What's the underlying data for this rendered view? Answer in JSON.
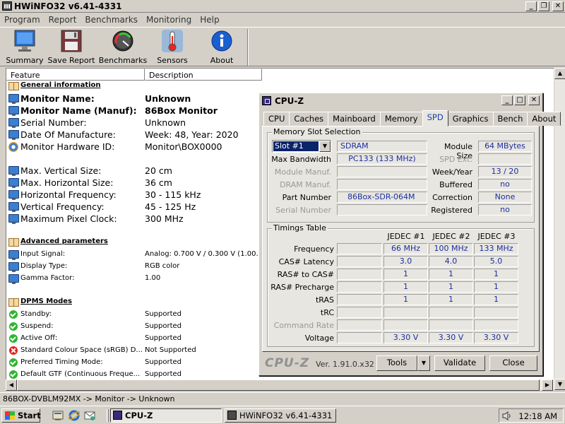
{
  "hwinfo": {
    "title": "HWiNFO32 v6.41-4331",
    "menu": [
      "Program",
      "Report",
      "Benchmarks",
      "Monitoring",
      "Help"
    ],
    "toolbar": [
      "Summary",
      "Save Report",
      "Benchmarks",
      "Sensors",
      "About"
    ],
    "columns": [
      "Feature",
      "Description"
    ],
    "sections": {
      "general": "General information",
      "advanced": "Advanced parameters",
      "dpms": "DPMS Modes"
    },
    "rows": [
      {
        "f": "Monitor Name:",
        "d": "Unknown"
      },
      {
        "f": "Monitor Name (Manuf):",
        "d": "86Box Monitor"
      },
      {
        "f": "Serial Number:",
        "d": "Unknown"
      },
      {
        "f": "Date Of Manufacture:",
        "d": "Week: 48, Year: 2020"
      },
      {
        "f": "Monitor Hardware ID:",
        "d": "Monitor\\BOX0000"
      },
      {
        "f": "Max. Vertical Size:",
        "d": "20 cm"
      },
      {
        "f": "Max. Horizontal Size:",
        "d": "36 cm"
      },
      {
        "f": "Horizontal Frequency:",
        "d": "30 - 115 kHz"
      },
      {
        "f": "Vertical Frequency:",
        "d": "45 - 125 Hz"
      },
      {
        "f": "Maximum Pixel Clock:",
        "d": "300 MHz"
      },
      {
        "f": "Input Signal:",
        "d": "Analog: 0.700 V / 0.300 V (1.00..."
      },
      {
        "f": "Display Type:",
        "d": "RGB color"
      },
      {
        "f": "Gamma Factor:",
        "d": "1.00"
      },
      {
        "f": "Standby:",
        "d": "Supported"
      },
      {
        "f": "Suspend:",
        "d": "Supported"
      },
      {
        "f": "Active Off:",
        "d": "Supported"
      },
      {
        "f": "Standard Colour Space (sRGB) D...",
        "d": "Not Supported"
      },
      {
        "f": "Preferred Timing Mode:",
        "d": "Supported"
      },
      {
        "f": "Default GTF (Continuous Freque...",
        "d": "Supported"
      }
    ],
    "status": "86BOX-DVBLM92MX -> Monitor -> Unknown"
  },
  "cpuz": {
    "title": "CPU-Z",
    "tabs": [
      "CPU",
      "Caches",
      "Mainboard",
      "Memory",
      "SPD",
      "Graphics",
      "Bench",
      "About"
    ],
    "active_tab": "SPD",
    "slot_group": "Memory Slot Selection",
    "slot": "Slot #1",
    "mem_type": "SDRAM",
    "labels": {
      "max_bw": "Max Bandwidth",
      "mod_manuf": "Module Manuf.",
      "dram_manuf": "DRAM Manuf.",
      "part": "Part Number",
      "serial": "Serial Number",
      "mod_size": "Module Size",
      "spd_ext": "SPD Ext.",
      "weekyear": "Week/Year",
      "buffered": "Buffered",
      "correction": "Correction",
      "registered": "Registered"
    },
    "values": {
      "max_bw": "PC133 (133 MHz)",
      "part": "86Box-SDR-064M",
      "mod_size": "64 MBytes",
      "weekyear": "13 / 20",
      "buffered": "no",
      "correction": "None",
      "registered": "no"
    },
    "timings": {
      "group": "Timings Table",
      "cols": [
        "JEDEC #1",
        "JEDEC #2",
        "JEDEC #3"
      ],
      "rows": [
        {
          "label": "Frequency",
          "v": [
            "66 MHz",
            "100 MHz",
            "133 MHz"
          ],
          "dim": false
        },
        {
          "label": "CAS# Latency",
          "v": [
            "3.0",
            "4.0",
            "5.0"
          ],
          "dim": false
        },
        {
          "label": "RAS# to CAS#",
          "v": [
            "1",
            "1",
            "1"
          ],
          "dim": false
        },
        {
          "label": "RAS# Precharge",
          "v": [
            "1",
            "1",
            "1"
          ],
          "dim": false
        },
        {
          "label": "tRAS",
          "v": [
            "1",
            "1",
            "1"
          ],
          "dim": false
        },
        {
          "label": "tRC",
          "v": [
            "",
            "",
            ""
          ],
          "dim": false
        },
        {
          "label": "Command Rate",
          "v": [
            "",
            "",
            ""
          ],
          "dim": true
        },
        {
          "label": "Voltage",
          "v": [
            "3.30 V",
            "3.30 V",
            "3.30 V"
          ],
          "dim": false
        }
      ]
    },
    "logo": "CPU-Z",
    "version": "Ver. 1.91.0.x32",
    "buttons": {
      "tools": "Tools",
      "validate": "Validate",
      "close": "Close"
    }
  },
  "taskbar": {
    "start": "Start",
    "tasks": [
      "CPU-Z",
      "HWiNFO32 v6.41-4331"
    ],
    "clock": "12:18 AM"
  }
}
